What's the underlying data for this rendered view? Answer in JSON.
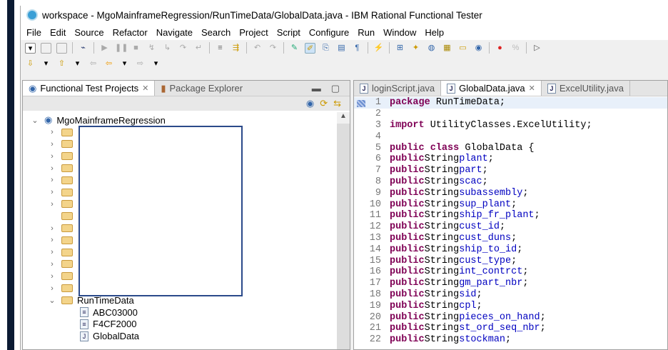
{
  "window": {
    "title": "workspace - MgoMainframeRegression/RunTimeData/GlobalData.java - IBM Rational Functional Tester"
  },
  "menu": [
    "File",
    "Edit",
    "Source",
    "Refactor",
    "Navigate",
    "Search",
    "Project",
    "Script",
    "Configure",
    "Run",
    "Window",
    "Help"
  ],
  "left_panel": {
    "tabs": [
      {
        "label": "Functional Test Projects",
        "active": true
      },
      {
        "label": "Package Explorer",
        "active": false
      }
    ],
    "tree": {
      "root": "MgoMainframeRegression",
      "folder_count": 14,
      "expanded_folder": "RunTimeData",
      "children": [
        "ABC03000",
        "F4CF2000",
        "GlobalData"
      ]
    }
  },
  "editor": {
    "tabs": [
      {
        "label": "loginScript.java",
        "active": false
      },
      {
        "label": "GlobalData.java",
        "active": true
      },
      {
        "label": "ExcelUtility.java",
        "active": false
      }
    ],
    "lines": [
      {
        "n": "1",
        "kw": "package",
        "rest": " RunTimeData;"
      },
      {
        "n": "2"
      },
      {
        "n": "3",
        "kw": "import",
        "rest": " UtilityClasses.ExcelUtility;"
      },
      {
        "n": "4"
      },
      {
        "n": "5",
        "kw": "public class",
        "rest": " GlobalData {"
      },
      {
        "n": "6",
        "field": "plant"
      },
      {
        "n": "7",
        "field": "part"
      },
      {
        "n": "8",
        "field": "scac"
      },
      {
        "n": "9",
        "field": "subassembly"
      },
      {
        "n": "10",
        "field": "sup_plant"
      },
      {
        "n": "11",
        "field": "ship_fr_plant"
      },
      {
        "n": "12",
        "field": "cust_id"
      },
      {
        "n": "13",
        "field": "cust_duns"
      },
      {
        "n": "14",
        "field": "ship_to_id"
      },
      {
        "n": "15",
        "field": "cust_type"
      },
      {
        "n": "16",
        "field": "int_contrct"
      },
      {
        "n": "17",
        "field": "gm_part_nbr"
      },
      {
        "n": "18",
        "field": "sid"
      },
      {
        "n": "19",
        "field": "cpl"
      },
      {
        "n": "20",
        "field": "pieces_on_hand"
      },
      {
        "n": "21",
        "field": "st_ord_seq_nbr"
      },
      {
        "n": "22",
        "field": "stockman"
      }
    ],
    "field_prefix_kw": "public",
    "field_type": "String"
  }
}
